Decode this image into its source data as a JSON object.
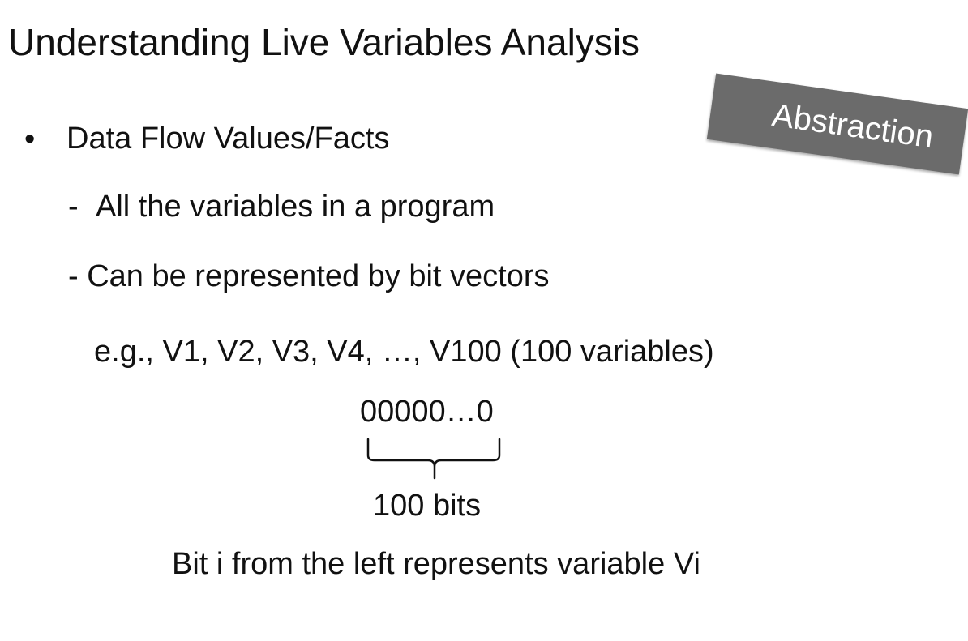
{
  "slide": {
    "title": "Understanding Live Variables Analysis",
    "bullet": {
      "marker": "•",
      "text": "Data Flow Values/Facts"
    },
    "sub_items": [
      {
        "dash": "-",
        "text": "All the variables in a program"
      },
      {
        "text": "- Can be represented by bit vectors"
      }
    ],
    "example": "e.g., V1, V2, V3, V4, …, V100 (100 variables)",
    "bit_vector": "00000…0",
    "bits_label": "100 bits",
    "explanation": "Bit i from the left represents variable Vi",
    "badge": {
      "text": "Abstraction",
      "background": "#6b6b6b",
      "text_color": "#ffffff"
    }
  }
}
